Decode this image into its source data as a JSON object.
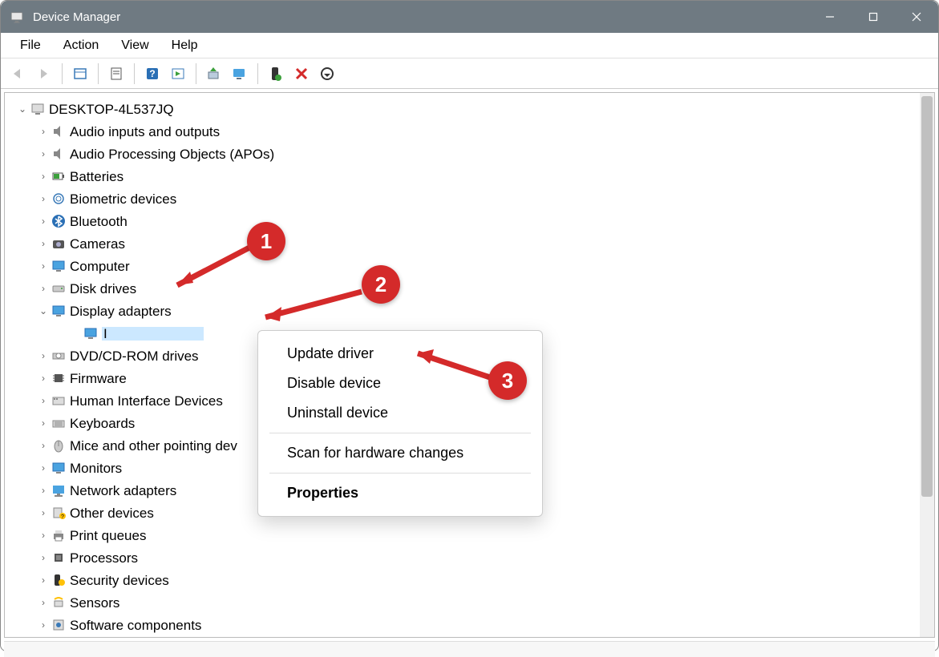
{
  "window": {
    "title": "Device Manager"
  },
  "menubar": {
    "file": "File",
    "action": "Action",
    "view": "View",
    "help": "Help"
  },
  "tree": {
    "root": "DESKTOP-4L537JQ",
    "audio_io": "Audio inputs and outputs",
    "apo": "Audio Processing Objects (APOs)",
    "batteries": "Batteries",
    "biometric": "Biometric devices",
    "bluetooth": "Bluetooth",
    "cameras": "Cameras",
    "computer": "Computer",
    "disk_drives": "Disk drives",
    "display_adapters": "Display adapters",
    "display_child": "I",
    "dvd": "DVD/CD-ROM drives",
    "firmware": "Firmware",
    "hid": "Human Interface Devices",
    "keyboards": "Keyboards",
    "mice": "Mice and other pointing dev",
    "monitors": "Monitors",
    "network": "Network adapters",
    "other": "Other devices",
    "print": "Print queues",
    "processors": "Processors",
    "security": "Security devices",
    "sensors": "Sensors",
    "software_components": "Software components"
  },
  "context_menu": {
    "update": "Update driver",
    "disable": "Disable device",
    "uninstall": "Uninstall device",
    "scan": "Scan for hardware changes",
    "properties": "Properties"
  },
  "annotations": {
    "b1": "1",
    "b2": "2",
    "b3": "3"
  }
}
